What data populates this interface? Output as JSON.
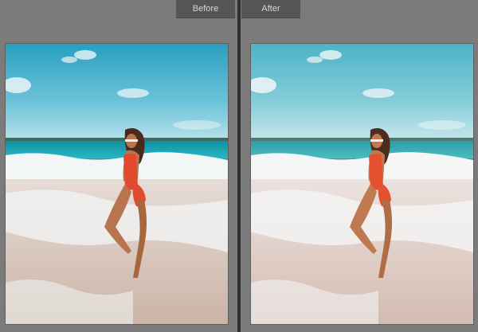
{
  "tabs": {
    "before_label": "Before",
    "after_label": "After"
  },
  "images": {
    "before": {
      "icon": "beach-photo-original"
    },
    "after": {
      "icon": "beach-photo-edited"
    }
  },
  "colors": {
    "sky_before": "#2aa6c4",
    "sky_after": "#52b5c9",
    "sea_before": "#18a3b3",
    "sea_after": "#3cb0b8",
    "sand_before": "#d9c3b5",
    "sand_after": "#e2cbc0",
    "swimsuit": "#e24a2f"
  }
}
